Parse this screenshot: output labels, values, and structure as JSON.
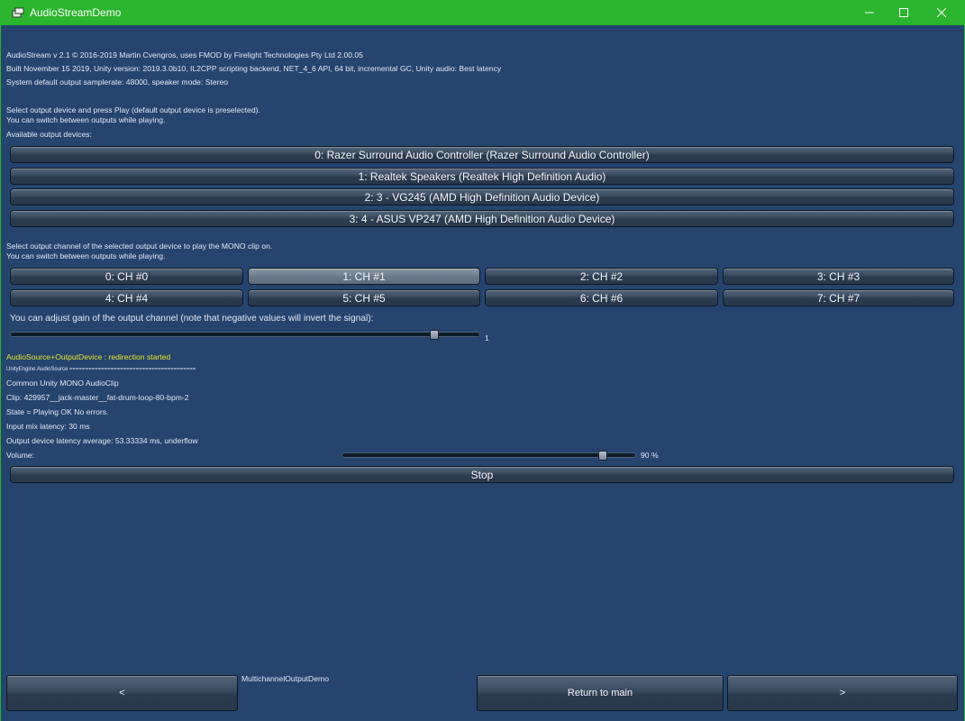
{
  "window": {
    "title": "AudioStreamDemo",
    "minimize_glyph": "—",
    "maximize_glyph": "☐",
    "close_glyph": "✕"
  },
  "info": {
    "line1": "AudioStream v 2.1 © 2016-2019 Martin Cvengros, uses FMOD by Firelight Technologies Pty Ltd 2.00.05",
    "line2": "Built November 15 2019, Unity version: 2019.3.0b10, IL2CPP scripting backend, NET_4_6 API, 64 bit, incremental GC,  Unity audio: Best latency",
    "line3": "System default output samplerate: 48000, speaker mode: Stereo"
  },
  "devices": {
    "instr1": "Select output device and press Play (default output device is preselected).",
    "instr2": "You can switch between outputs while playing.",
    "header": "Available output devices:",
    "items": [
      {
        "label": "0: Razer Surround Audio Controller (Razer Surround Audio Controller)"
      },
      {
        "label": "1: Realtek Speakers (Realtek High Definition Audio)"
      },
      {
        "label": "2: 3 - VG245 (AMD High Definition Audio Device)"
      },
      {
        "label": "3: 4 - ASUS VP247 (AMD High Definition Audio Device)"
      }
    ]
  },
  "channels": {
    "instr1": "Select output channel of the selected output device to play the MONO clip on.",
    "instr2": "You can switch between outputs while playing.",
    "selected_index": 1,
    "items": [
      {
        "label": "0: CH #0"
      },
      {
        "label": "1: CH #1"
      },
      {
        "label": "2: CH #2"
      },
      {
        "label": "3: CH #3"
      },
      {
        "label": "4: CH #4"
      },
      {
        "label": "5: CH #5"
      },
      {
        "label": "6: CH #6"
      },
      {
        "label": "7: CH #7"
      }
    ]
  },
  "gain": {
    "label": "You can adjust gain of the output channel (note that negative values will invert the signal):",
    "value_text": "1",
    "value": 1,
    "fraction": 0.91
  },
  "status": {
    "redirect": "AudioSource+OutputDevice : redirection started",
    "source_line": "UnityEngine.AudioSource  ========================================",
    "clip_type": "Common Unity MONO AudioClip",
    "clip": "Clip: 429957__jack-master__fat-drum-loop-80-bpm-2",
    "state": "State = Playing OK No errors.",
    "input_latency": "Input mix latency: 30 ms",
    "output_latency": "Output device latency average: 53.33334 ms, underflow",
    "volume_label": "Volume:",
    "volume_text": "90 %",
    "volume_fraction": 0.9
  },
  "stop_button": "Stop",
  "footer": {
    "demo_name": "MultichannelOutputDemo",
    "prev_label": "<",
    "main_label": "Return to main",
    "next_label": ">"
  },
  "colors": {
    "background": "#25456f",
    "titlebar": "#2bb52e",
    "status_text": "#e8e12a"
  }
}
